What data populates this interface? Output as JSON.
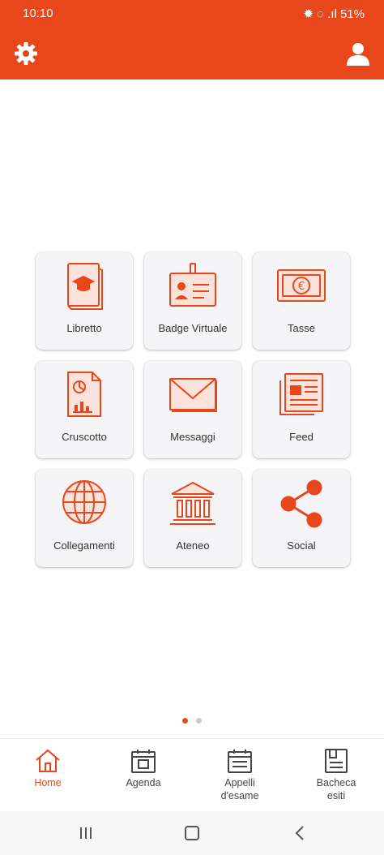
{
  "status_bar": {
    "time": "10:10",
    "right": "✹ ◌ .ıl 51%"
  },
  "header": {
    "settings_icon": "gear-icon",
    "profile_icon": "user-icon",
    "accent_color": "#e8471c"
  },
  "tiles": [
    {
      "label": "Libretto",
      "icon": "book-graduation-cap-icon"
    },
    {
      "label": "Badge Virtuale",
      "icon": "id-badge-icon"
    },
    {
      "label": "Tasse",
      "icon": "euro-banknote-icon"
    },
    {
      "label": "Cruscotto",
      "icon": "dashboard-document-icon"
    },
    {
      "label": "Messaggi",
      "icon": "envelope-icon"
    },
    {
      "label": "Feed",
      "icon": "newspaper-icon"
    },
    {
      "label": "Collegamenti",
      "icon": "globe-icon"
    },
    {
      "label": "Ateneo",
      "icon": "university-building-icon"
    },
    {
      "label": "Social",
      "icon": "share-icon"
    }
  ],
  "pager": {
    "pages": 2,
    "current": 1
  },
  "bottom_nav": [
    {
      "label": "Home",
      "icon": "home-icon",
      "active": true
    },
    {
      "label": "Agenda",
      "icon": "calendar-icon",
      "active": false
    },
    {
      "label": "Appelli d'esame",
      "icon": "calendar-exam-icon",
      "active": false
    },
    {
      "label": "Bacheca esiti",
      "icon": "board-results-icon",
      "active": false
    }
  ],
  "system_nav": {
    "recents_icon": "recents-icon",
    "home_icon": "home-square-icon",
    "back_icon": "back-chevron-icon"
  }
}
